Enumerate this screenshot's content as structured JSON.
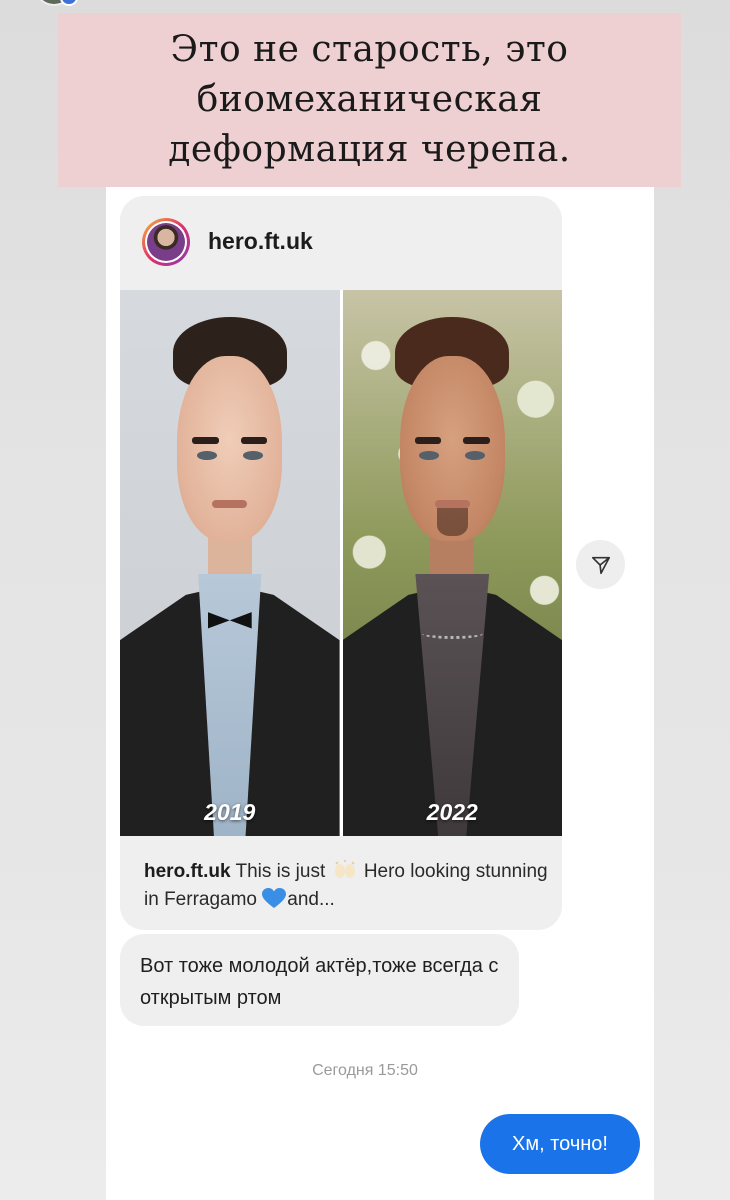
{
  "story_caption": "Это не старость, это биомеханическая деформация черепа.",
  "shared_post": {
    "username": "hero.ft.uk",
    "photos": [
      {
        "year": "2019"
      },
      {
        "year": "2022"
      }
    ],
    "caption": {
      "username": "hero.ft.uk",
      "text_before_emoji": "This is just",
      "emoji_1": "raising-hands-icon",
      "text_after_emoji": "Hero looking stunning in Ferragamo",
      "emoji_2": "blue-heart-icon",
      "text_end": "and..."
    }
  },
  "message": {
    "text": "Вот тоже молодой актёр,тоже всегда с открытым ртом"
  },
  "timestamp": "Сегодня 15:50",
  "reply": {
    "text": "Хм, точно!"
  },
  "colors": {
    "caption_banner": "#efd0d2",
    "bubble_gray": "#efefef",
    "reply_blue": "#1a73e8",
    "heart_blue": "#3a8ee6"
  }
}
